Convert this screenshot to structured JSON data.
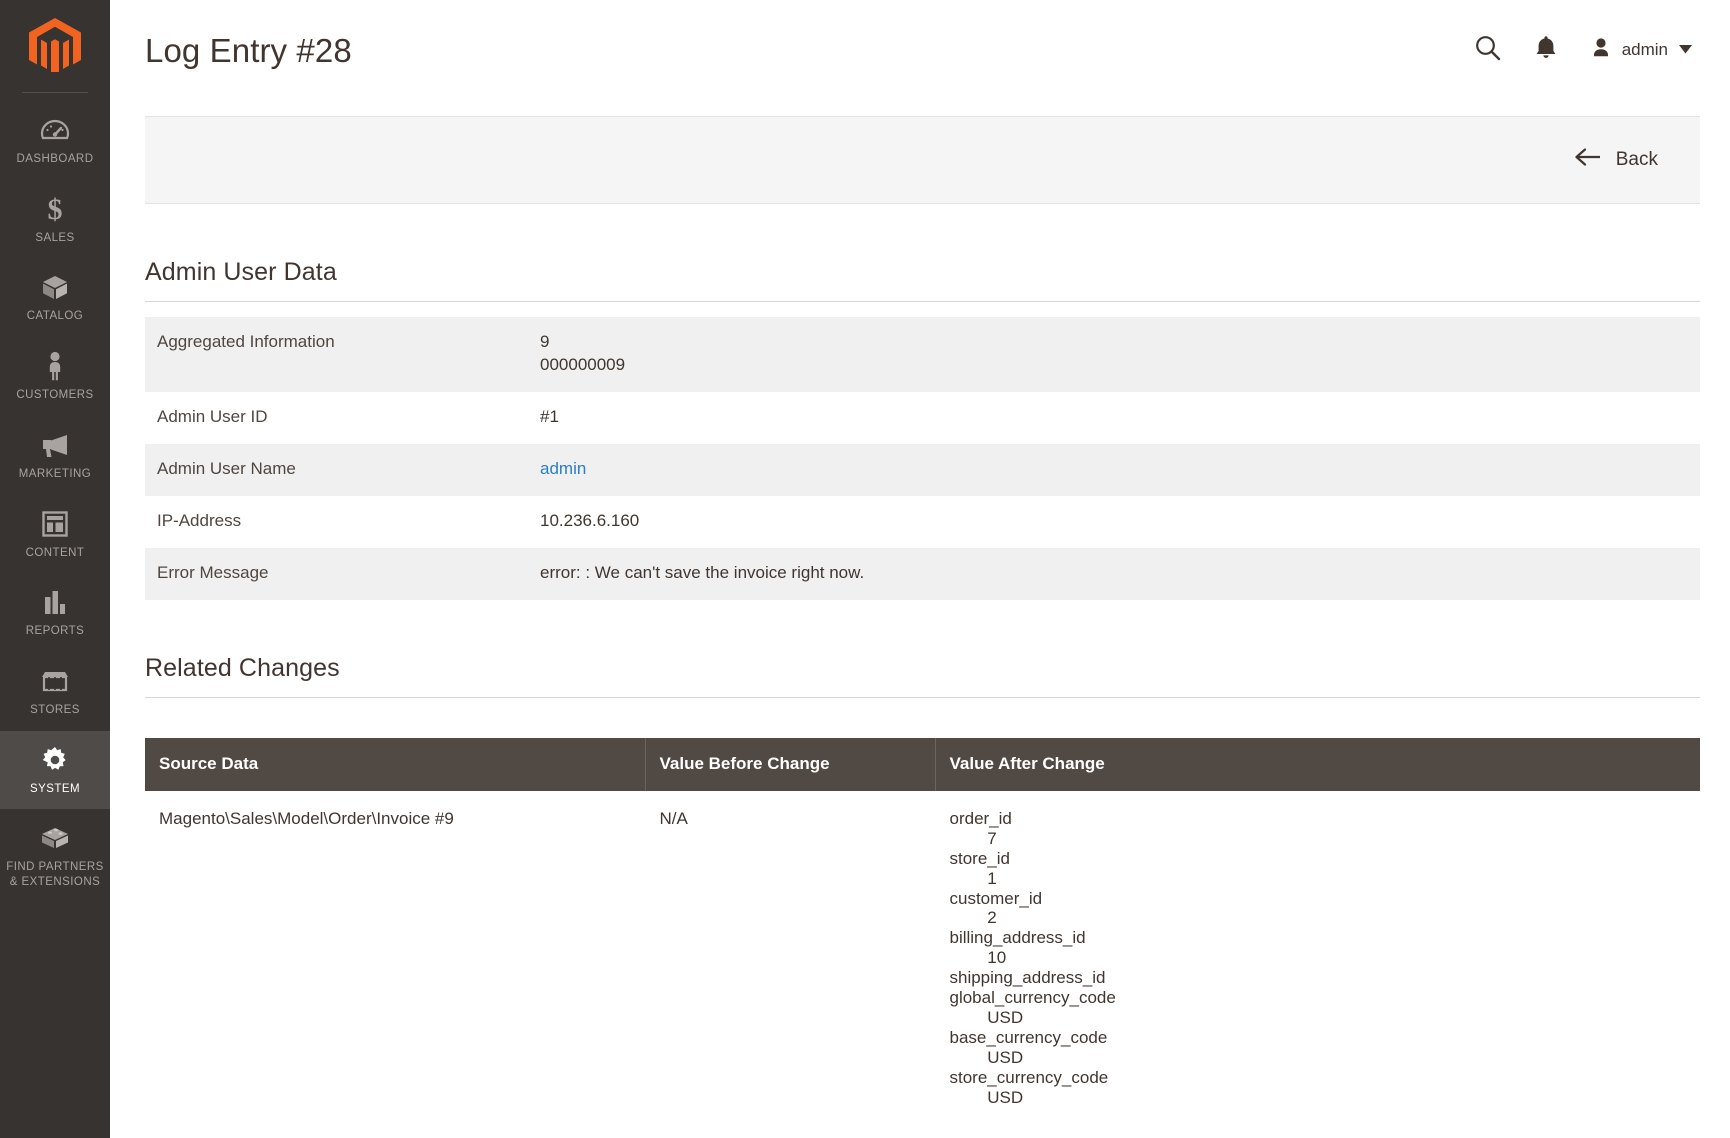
{
  "sidebar": {
    "logo_name": "magento-logo",
    "items": [
      {
        "label": "DASHBOARD",
        "icon": "dashboard-gauge-icon",
        "active": false
      },
      {
        "label": "SALES",
        "icon": "dollar-sign-icon",
        "active": false
      },
      {
        "label": "CATALOG",
        "icon": "box-icon",
        "active": false
      },
      {
        "label": "CUSTOMERS",
        "icon": "person-icon",
        "active": false
      },
      {
        "label": "MARKETING",
        "icon": "megaphone-icon",
        "active": false
      },
      {
        "label": "CONTENT",
        "icon": "layout-window-icon",
        "active": false
      },
      {
        "label": "REPORTS",
        "icon": "bar-chart-icon",
        "active": false
      },
      {
        "label": "STORES",
        "icon": "storefront-icon",
        "active": false
      },
      {
        "label": "SYSTEM",
        "icon": "gear-icon",
        "active": true
      },
      {
        "label": "FIND PARTNERS\n& EXTENSIONS",
        "icon": "puzzle-block-icon",
        "active": false
      }
    ]
  },
  "header": {
    "title": "Log Entry #28",
    "search_icon": "search-icon",
    "notifications_icon": "bell-icon",
    "user_icon": "user-avatar-icon",
    "user_name": "admin",
    "caret_icon": "chevron-down-icon"
  },
  "toolbar": {
    "back_label": "Back",
    "back_icon": "arrow-left-icon"
  },
  "admin_user_data": {
    "section_title": "Admin User Data",
    "rows": [
      {
        "label": "Aggregated Information",
        "values": [
          "9",
          "000000009"
        ],
        "type": "text"
      },
      {
        "label": "Admin User ID",
        "values": [
          "#1"
        ],
        "type": "text"
      },
      {
        "label": "Admin User Name",
        "values": [
          "admin"
        ],
        "type": "link"
      },
      {
        "label": "IP-Address",
        "values": [
          "10.236.6.160"
        ],
        "type": "text"
      },
      {
        "label": "Error Message",
        "values": [
          "error: : We can't save the invoice right now."
        ],
        "type": "text"
      }
    ]
  },
  "related_changes": {
    "section_title": "Related Changes",
    "columns": [
      "Source Data",
      "Value Before Change",
      "Value After Change"
    ],
    "rows": [
      {
        "source_data": "Magento\\Sales\\Model\\Order\\Invoice #9",
        "value_before": "N/A",
        "value_after": "order_id\n        7\nstore_id\n        1\ncustomer_id\n        2\nbilling_address_id\n        10\nshipping_address_id\nglobal_currency_code\n        USD\nbase_currency_code\n        USD\nstore_currency_code\n        USD"
      }
    ]
  },
  "colors": {
    "sidebar_bg": "#373330",
    "sidebar_active_bg": "#4f4b48",
    "accent_orange": "#f26322",
    "table_header_bg": "#514943",
    "link_blue": "#2a7fc0",
    "text_dark": "#41362f",
    "row_stripe": "#f0f0f0",
    "toolbar_bg": "#f5f5f5"
  }
}
